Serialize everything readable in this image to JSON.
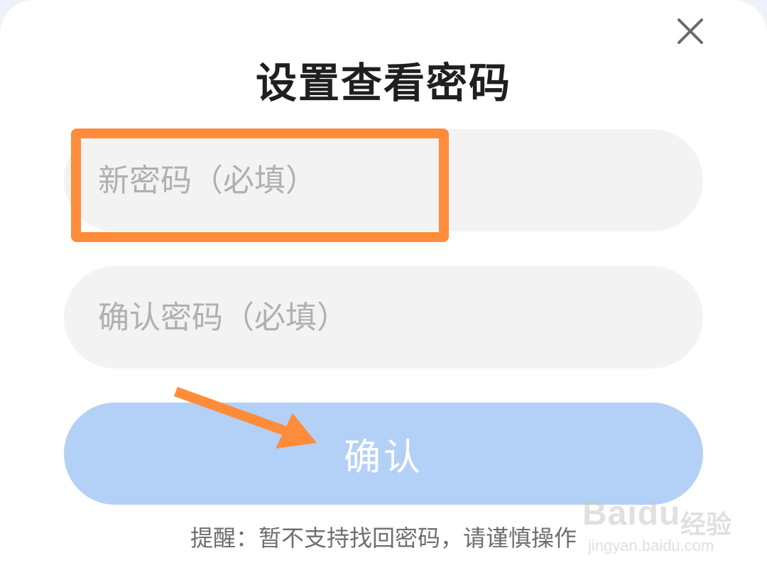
{
  "dialog": {
    "title": "设置查看密码",
    "close_icon": "close-icon"
  },
  "form": {
    "new_password": {
      "placeholder": "新密码（必填）",
      "value": ""
    },
    "confirm_password": {
      "placeholder": "确认密码（必填）",
      "value": ""
    },
    "submit_label": "确认",
    "hint": "提醒：暂不支持找回密码，请谨慎操作"
  },
  "annotation": {
    "highlight_color": "#ff8c3a",
    "arrow_color": "#ff8c3a"
  },
  "watermark": {
    "logo": "Baidu",
    "brand": "经验",
    "url": "jingyan.baidu.com"
  },
  "colors": {
    "field_bg": "#f3f3f3",
    "button_bg": "#b3d1f6",
    "title": "#1f1f1f",
    "hint": "#6e6e6e"
  }
}
